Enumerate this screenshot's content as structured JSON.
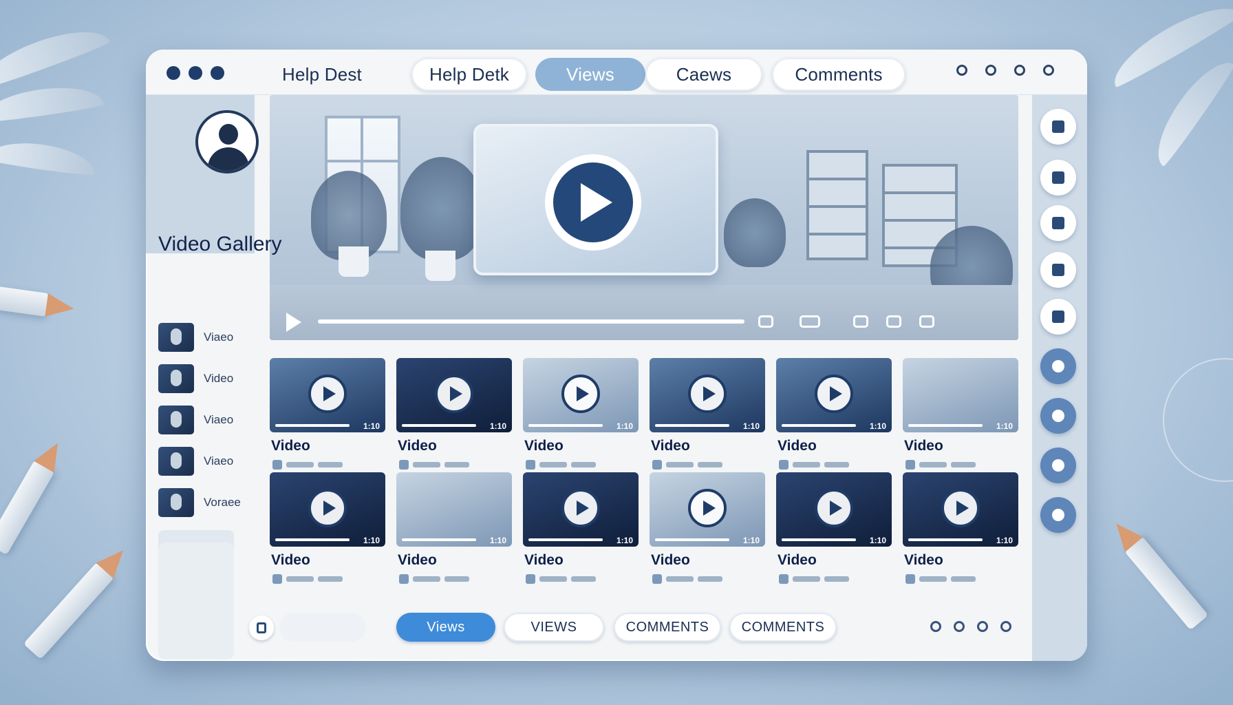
{
  "window": {
    "tabs": [
      {
        "label": "Help Dest",
        "style": "plain"
      },
      {
        "label": "Help Detk",
        "style": "pill"
      },
      {
        "label": "Views",
        "style": "active"
      },
      {
        "label": "Caews",
        "style": "pill"
      },
      {
        "label": "Comments",
        "style": "pill"
      }
    ]
  },
  "sidebar": {
    "title": "Video Gallery",
    "items": [
      {
        "label": "Viaeo"
      },
      {
        "label": "Video"
      },
      {
        "label": "Viaeo"
      },
      {
        "label": "Viaeo"
      },
      {
        "label": "Voraee"
      }
    ]
  },
  "player": {
    "state": "paused",
    "progress_fraction": 0.0
  },
  "grid": {
    "rows": [
      [
        {
          "title": "Video",
          "duration": "1:10"
        },
        {
          "title": "Video",
          "duration": "1:10"
        },
        {
          "title": "Video",
          "duration": "1:10"
        },
        {
          "title": "Video",
          "duration": "1:10"
        },
        {
          "title": "Video",
          "duration": "1:10"
        },
        {
          "title": "Video",
          "duration": "1:10"
        }
      ],
      [
        {
          "title": "Video",
          "duration": "1:10"
        },
        {
          "title": "Video",
          "duration": "1:10"
        },
        {
          "title": "Video",
          "duration": "1:10"
        },
        {
          "title": "Video",
          "duration": "1:10"
        },
        {
          "title": "Video",
          "duration": "1:10"
        },
        {
          "title": "Video",
          "duration": "1:10"
        }
      ]
    ]
  },
  "bottombar": {
    "buttons": [
      {
        "label": "Views",
        "active": true
      },
      {
        "label": "VIEWS",
        "active": false
      },
      {
        "label": "COMMENTS",
        "active": false
      },
      {
        "label": "COMMENTS",
        "active": false
      }
    ]
  },
  "colors": {
    "accent": "#3e8bd9",
    "active_tab": "#8fb3d6",
    "navy": "#1f3c68"
  }
}
